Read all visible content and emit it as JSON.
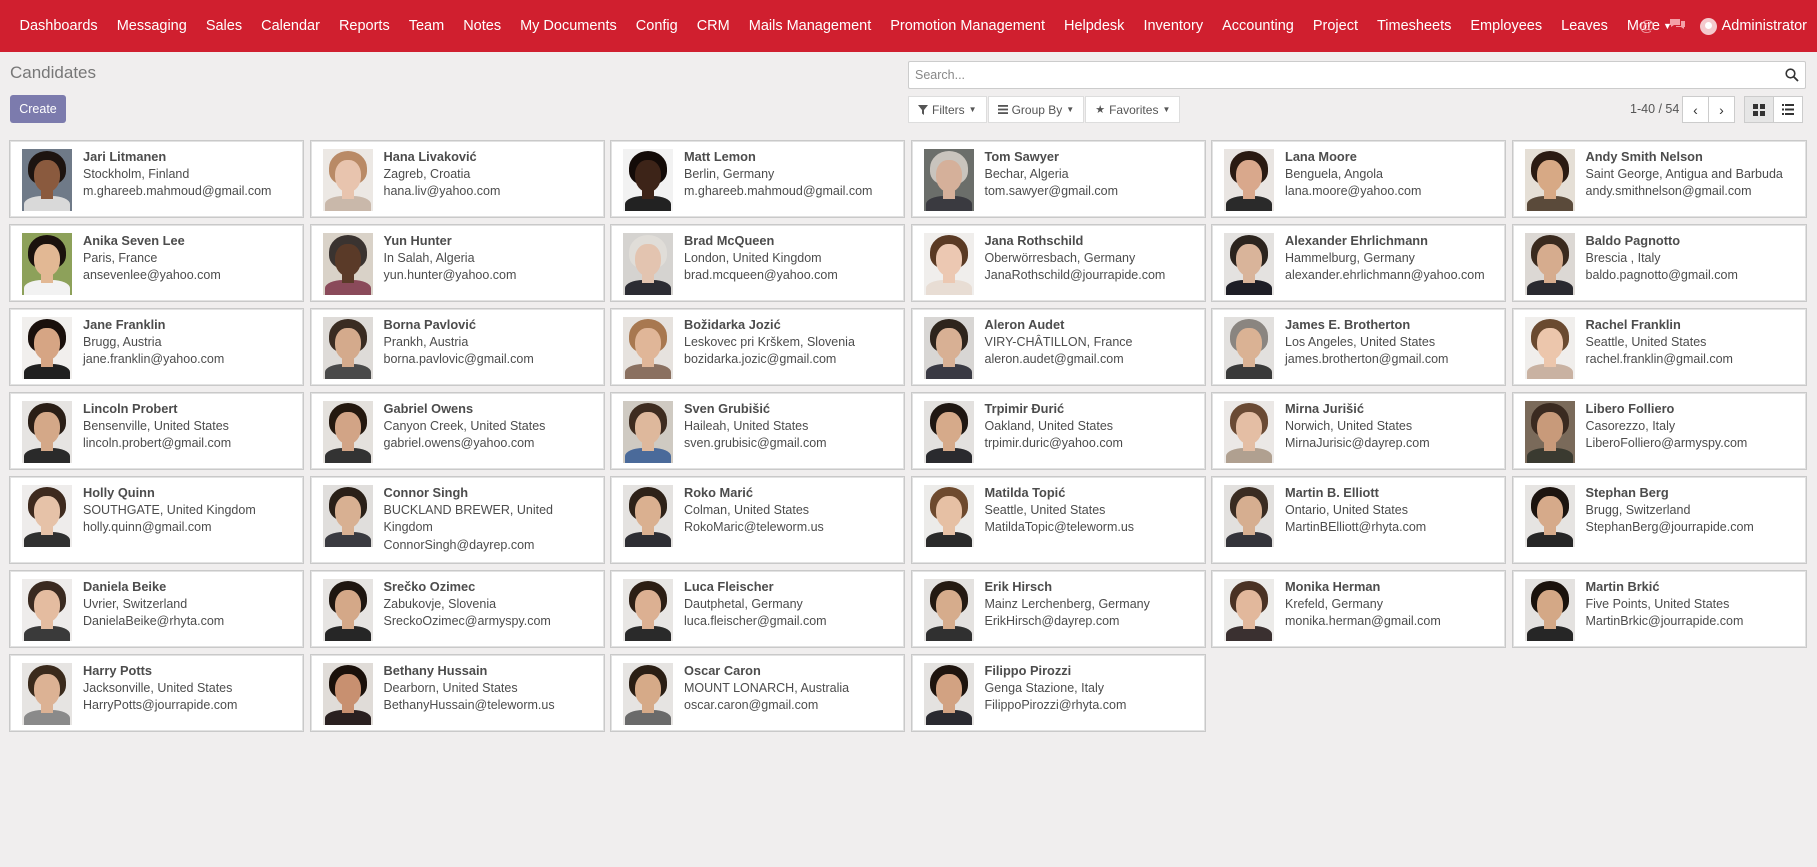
{
  "nav": {
    "items": [
      "Dashboards",
      "Messaging",
      "Sales",
      "Calendar",
      "Reports",
      "Team",
      "Notes",
      "My Documents",
      "Config",
      "CRM",
      "Mails Management",
      "Promotion Management",
      "Helpdesk",
      "Inventory",
      "Accounting",
      "Project",
      "Timesheets",
      "Employees",
      "Leaves",
      "More"
    ],
    "user": "Administrator"
  },
  "page": {
    "title": "Candidates",
    "create_label": "Create",
    "search_placeholder": "Search...",
    "filters_label": "Filters",
    "groupby_label": "Group By",
    "favorites_label": "Favorites",
    "pager": "1-40 / 54"
  },
  "colors": {
    "nav": "#d01f2f",
    "create": "#7c7bad"
  },
  "candidates": [
    {
      "name": "Jari Litmanen",
      "location": "Stockholm, Finland",
      "email": "m.ghareeb.mahmoud@gmail.com",
      "tone": "#8a5a3e",
      "hair": "#1d1410",
      "bg": "#6f7a88",
      "shirt": "#d9d9d9"
    },
    {
      "name": "Hana Livaković",
      "location": "Zagreb, Croatia",
      "email": "hana.liv@yahoo.com",
      "tone": "#e8c4ae",
      "hair": "#b98a66",
      "bg": "#ece8e4",
      "shirt": "#c9b8aa"
    },
    {
      "name": "Matt Lemon",
      "location": "Berlin, Germany",
      "email": "m.ghareeb.mahmoud@gmail.com",
      "tone": "#3d2418",
      "hair": "#130b08",
      "bg": "#f2f2f2",
      "shirt": "#222222"
    },
    {
      "name": "Tom Sawyer",
      "location": "Bechar, Algeria",
      "email": "tom.sawyer@gmail.com",
      "tone": "#d5b09a",
      "hair": "#c9c4bd",
      "bg": "#6b6e6a",
      "shirt": "#3a3a40"
    },
    {
      "name": "Lana Moore",
      "location": "Benguela, Angola",
      "email": "lana.moore@yahoo.com",
      "tone": "#d9a88c",
      "hair": "#2a1a12",
      "bg": "#e9e5e2",
      "shirt": "#2a2a2a"
    },
    {
      "name": "Andy Smith Nelson",
      "location": "Saint George, Antigua and Barbuda",
      "email": "andy.smithnelson@gmail.com",
      "tone": "#d7a985",
      "hair": "#2b1b12",
      "bg": "#e5dfd6",
      "shirt": "#5a4a3a"
    },
    {
      "name": "Anika Seven Lee",
      "location": "Paris, France",
      "email": "ansevenlee@yahoo.com",
      "tone": "#e2b894",
      "hair": "#1b120d",
      "bg": "#8da15a",
      "shirt": "#f2f2f2"
    },
    {
      "name": "Yun Hunter",
      "location": "In Salah, Algeria",
      "email": "yun.hunter@yahoo.com",
      "tone": "#5a3a28",
      "hair": "#3a3330",
      "bg": "#d9d2c8",
      "shirt": "#8a4a5a"
    },
    {
      "name": "Brad McQueen",
      "location": "London, United Kingdom",
      "email": "brad.mcqueen@yahoo.com",
      "tone": "#e3c4b0",
      "hair": "#e0ddd8",
      "bg": "#d5d3d0",
      "shirt": "#2c2c33"
    },
    {
      "name": "Jana Rothschild",
      "location": "Oberwörresbach, Germany",
      "email": "JanaRothschild@jourrapide.com",
      "tone": "#ecc8b2",
      "hair": "#5a3a24",
      "bg": "#f0eeec",
      "shirt": "#e8ddd4"
    },
    {
      "name": "Alexander Ehrlichmann",
      "location": "Hammelburg, Germany",
      "email": "alexander.ehrlichmann@yahoo.com",
      "tone": "#d9b49a",
      "hair": "#2c241e",
      "bg": "#e4e2e0",
      "shirt": "#1e1e26"
    },
    {
      "name": "Baldo Pagnotto",
      "location": "Brescia , Italy",
      "email": "baldo.pagnotto@gmail.com",
      "tone": "#d6ac8e",
      "hair": "#3a2a1e",
      "bg": "#dcd8d4",
      "shirt": "#2a2a30"
    },
    {
      "name": "Jane Franklin",
      "location": "Brugg, Austria",
      "email": "jane.franklin@yahoo.com",
      "tone": "#d6a584",
      "hair": "#1a100c",
      "bg": "#f1efed",
      "shirt": "#202020"
    },
    {
      "name": "Borna Pavlović",
      "location": "Prankh, Austria",
      "email": "borna.pavlovic@gmail.com",
      "tone": "#d4aa8c",
      "hair": "#3a2c22",
      "bg": "#dedbd8",
      "shirt": "#4a4a4a"
    },
    {
      "name": "Božidarka Jozić",
      "location": "Leskovec pri Krškem, Slovenia",
      "email": "bozidarka.jozic@gmail.com",
      "tone": "#e0b698",
      "hair": "#a87850",
      "bg": "#e6e2de",
      "shirt": "#8a7060"
    },
    {
      "name": "Aleron Audet",
      "location": "VIRY-CHÂTILLON, France",
      "email": "aleron.audet@gmail.com",
      "tone": "#d8b094",
      "hair": "#2e241c",
      "bg": "#d8d6d4",
      "shirt": "#3a3a44"
    },
    {
      "name": "James E. Brotherton",
      "location": "Los Angeles, United States",
      "email": "james.brotherton@gmail.com",
      "tone": "#dab294",
      "hair": "#8a8580",
      "bg": "#e2e0de",
      "shirt": "#3a3a3a"
    },
    {
      "name": "Rachel Franklin",
      "location": "Seattle, United States",
      "email": "rachel.franklin@gmail.com",
      "tone": "#ecc6ac",
      "hair": "#6a4a30",
      "bg": "#f0eeec",
      "shirt": "#c9b2a2"
    },
    {
      "name": "Lincoln Probert",
      "location": "Bensenville, United States",
      "email": "lincoln.probert@gmail.com",
      "tone": "#d4a888",
      "hair": "#2a1e16",
      "bg": "#e6e4e2",
      "shirt": "#2a2a2a"
    },
    {
      "name": "Gabriel Owens",
      "location": "Canyon Creek, United States",
      "email": "gabriel.owens@yahoo.com",
      "tone": "#d2a486",
      "hair": "#24180f",
      "bg": "#e4e1dd",
      "shirt": "#333333"
    },
    {
      "name": "Sven Grubišić",
      "location": "Haileah, United States",
      "email": "sven.grubisic@gmail.com",
      "tone": "#deb89c",
      "hair": "#3e2c20",
      "bg": "#cfcac2",
      "shirt": "#4a6a9a"
    },
    {
      "name": "Trpimir Đurić",
      "location": "Oakland, United States",
      "email": "trpimir.duric@yahoo.com",
      "tone": "#d6aa8a",
      "hair": "#1f1712",
      "bg": "#e3e1df",
      "shirt": "#2a2a2e"
    },
    {
      "name": "Mirna Jurišić",
      "location": "Norwich, United States",
      "email": "MirnaJurisic@dayrep.com",
      "tone": "#e4bea4",
      "hair": "#6a4a34",
      "bg": "#ebe8e6",
      "shirt": "#b0a090"
    },
    {
      "name": "Libero Folliero",
      "location": "Casorezzo, Italy",
      "email": "LiberoFolliero@armyspy.com",
      "tone": "#c89a7a",
      "hair": "#3a2a20",
      "bg": "#7a6a5a",
      "shirt": "#3a3a30"
    },
    {
      "name": "Holly Quinn",
      "location": "SOUTHGATE, United Kingdom",
      "email": "holly.quinn@gmail.com",
      "tone": "#e6c2a8",
      "hair": "#3e2a1e",
      "bg": "#eeeceb",
      "shirt": "#303030"
    },
    {
      "name": "Connor Singh",
      "location": "BUCKLAND BREWER, United Kingdom",
      "email": "ConnorSingh@dayrep.com",
      "tone": "#d8b092",
      "hair": "#2a2018",
      "bg": "#e0dedc",
      "shirt": "#3a3a40"
    },
    {
      "name": "Roko Marić",
      "location": "Colman, United States",
      "email": "RokoMaric@teleworm.us",
      "tone": "#dab090",
      "hair": "#2e2218",
      "bg": "#e4e2e0",
      "shirt": "#2e2e33"
    },
    {
      "name": "Matilda Topić",
      "location": "Seattle, United States",
      "email": "MatildaTopic@teleworm.us",
      "tone": "#e6c0a4",
      "hair": "#6e4a2e",
      "bg": "#ecebe9",
      "shirt": "#2a2a2a"
    },
    {
      "name": "Martin B. Elliott",
      "location": "Ontario, United States",
      "email": "MartinBElliott@rhyta.com",
      "tone": "#d6ae90",
      "hair": "#3a2c22",
      "bg": "#e2e0de",
      "shirt": "#34343a"
    },
    {
      "name": "Stephan Berg",
      "location": "Brugg, Switzerland",
      "email": "StephanBerg@jourrapide.com",
      "tone": "#d6aa8a",
      "hair": "#1c140f",
      "bg": "#e6e4e2",
      "shirt": "#262626"
    },
    {
      "name": "Daniela Beike",
      "location": "Uvrier, Switzerland",
      "email": "DanielaBeike@rhyta.com",
      "tone": "#e4bca0",
      "hair": "#3a2a20",
      "bg": "#eeeceb",
      "shirt": "#3a3a3a"
    },
    {
      "name": "Srečko Ozimec",
      "location": "Zabukovje, Slovenia",
      "email": "SreckoOzimec@armyspy.com",
      "tone": "#d4a888",
      "hair": "#1e1610",
      "bg": "#e6e4e2",
      "shirt": "#262626"
    },
    {
      "name": "Luca Fleischer",
      "location": "Dautphetal, Germany",
      "email": "luca.fleischer@gmail.com",
      "tone": "#dcb092",
      "hair": "#2c1e14",
      "bg": "#e8e6e4",
      "shirt": "#2a2a2a"
    },
    {
      "name": "Erik Hirsch",
      "location": "Mainz Lerchenberg, Germany",
      "email": "ErikHirsch@dayrep.com",
      "tone": "#d6ac8c",
      "hair": "#241a12",
      "bg": "#e4e2e0",
      "shirt": "#303030"
    },
    {
      "name": "Monika Herman",
      "location": "Krefeld, Germany",
      "email": "monika.herman@gmail.com",
      "tone": "#e2b89c",
      "hair": "#4a3224",
      "bg": "#ecebe9",
      "shirt": "#3a3030"
    },
    {
      "name": "Martin Brkić",
      "location": "Five Points, United States",
      "email": "MartinBrkic@jourrapide.com",
      "tone": "#d4a886",
      "hair": "#1a120c",
      "bg": "#e4e2e0",
      "shirt": "#262626"
    },
    {
      "name": "Harry Potts",
      "location": "Jacksonville, United States",
      "email": "HarryPotts@jourrapide.com",
      "tone": "#dcb294",
      "hair": "#3a2a1c",
      "bg": "#e6e4e2",
      "shirt": "#8a8a8a"
    },
    {
      "name": "Bethany Hussain",
      "location": "Dearborn, United States",
      "email": "BethanyHussain@teleworm.us",
      "tone": "#c89070",
      "hair": "#1a100a",
      "bg": "#e0dcd8",
      "shirt": "#2a2020"
    },
    {
      "name": "Oscar Caron",
      "location": "MOUNT LONARCH, Australia",
      "email": "oscar.caron@gmail.com",
      "tone": "#d6aa88",
      "hair": "#2a1e14",
      "bg": "#e6e4e2",
      "shirt": "#6a6a6a"
    },
    {
      "name": "Filippo Pirozzi",
      "location": "Genga Stazione, Italy",
      "email": "FilippoPirozzi@rhyta.com",
      "tone": "#d2a282",
      "hair": "#1e140e",
      "bg": "#e4e2e0",
      "shirt": "#2a2a30"
    }
  ]
}
